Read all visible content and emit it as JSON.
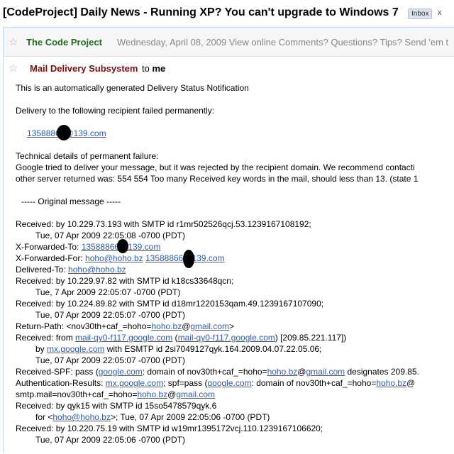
{
  "subject": "[CodeProject] Daily News - Running XP? You can't upgrade to Windows 7",
  "label": "Inbox",
  "label_close": "x",
  "collapsed_message": {
    "sender": "The Code Project",
    "snippet": "Wednesday, April 08, 2009 View online Comments? Questions? Tips? Send 'em t"
  },
  "expanded_message": {
    "sender": "Mail Delivery Subsystem",
    "to_prefix": "to",
    "to_name": "me"
  },
  "body": {
    "intro": "This is an automatically generated Delivery Status Notification",
    "failed_line": "Delivery to the following recipient failed permanently:",
    "recipient": "13588866@139.com",
    "tech_heading": "Technical details of permanent failure:",
    "tech_line1": "Google tried to deliver your message, but it was rejected by the recipient domain. We recommend contacti",
    "tech_line2": "other server returned was: 554 554 Too many Received key words in the mail, should less than 13. (state 1",
    "orig_sep": "----- Original message -----",
    "h1": "Received: by 10.229.73.193 with SMTP id r1mr502526qcj.53.1239167108192;",
    "h2": "Tue, 07 Apr 2009 22:05:08 -0700 (PDT)",
    "h3_label": "X-Forwarded-To:",
    "h3_link": "13588866@139.com",
    "h4_label": "X-Forwarded-For:",
    "h4_link1": "hoho@hoho.bz",
    "h4_link2": "13588866@139.com",
    "h5_label": "Delivered-To:",
    "h5_link": "hoho@hoho.bz",
    "h6": "Received: by 10.229.97.82 with SMTP id k18cs33648qcn;",
    "h7": "Tue, 7 Apr 2009 22:05:07 -0700 (PDT)",
    "h8": "Received: by 10.224.89.82 with SMTP id d18mr1220153qam.49.1239167107090;",
    "h9": "Tue, 07 Apr 2009 22:05:07 -0700 (PDT)",
    "h10_pre": "Return-Path: <nov30th+caf_=hoho=",
    "h10_link1": "hoho.bz",
    "h10_at": "@",
    "h10_link2": "gmail.com",
    "h10_post": ">",
    "h11_pre": "Received: from ",
    "h11_link1": "mail-qy0-f117.google.com",
    "h11_open": " (",
    "h11_link2": "mail-qy0-f117.google.com",
    "h11_post": ") [209.85.221.117])",
    "h12_pre": "by ",
    "h12_link": "mx.google.com",
    "h12_post": " with ESMTP id 2si7049127qyk.164.2009.04.07.22.05.06;",
    "h13": "Tue, 07 Apr 2009 22:05:07 -0700 (PDT)",
    "h14_pre": "Received-SPF: pass (",
    "h14_link1": "google.com",
    "h14_mid": ": domain of nov30th+caf_=hoho=",
    "h14_link2": "hoho.bz",
    "h14_at": "@",
    "h14_link3": "gmail.com",
    "h14_post": " designates 209.85.",
    "h15_pre": "Authentication-Results: ",
    "h15_link1": "mx.google.com",
    "h15_mid1": "; spf=pass (",
    "h15_link2": "google.com",
    "h15_mid2": ": domain of nov30th+caf_=hoho=",
    "h15_link3": "hoho.bz",
    "h15_at": "@",
    "h16_pre": "smtp.mail=nov30th+caf_=hoho=",
    "h16_link1": "hoho.bz",
    "h16_at": "@",
    "h16_link2": "gmail.com",
    "h17": "Received: by qyk15 with SMTP id 15so5478579qyk.6",
    "h18_pre": "for <",
    "h18_link": "hoho@hoho.bz",
    "h18_post": ">; Tue, 07 Apr 2009 22:05:06 -0700 (PDT)",
    "h19": "Received: by 10.220.75.19 with SMTP id w19mr1395172vcj.110.1239167106620;",
    "h20": "Tue, 07 Apr 2009 22:05:06 -0700 (PDT)"
  }
}
